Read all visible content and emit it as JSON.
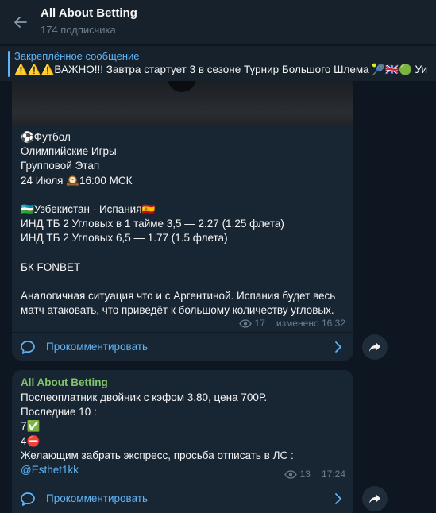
{
  "header": {
    "title": "All About Betting",
    "subtitle": "174 подписчика"
  },
  "pinned": {
    "label": "Закреплённое сообщение",
    "text": "⚠️⚠️⚠️ВАЖНО!!! Завтра стартует 3 в сезоне Турнир Большого Шлема 🎾🇬🇧🟢 Уи"
  },
  "post1": {
    "lines": [
      "⚽Футбол",
      "Олимпийские Игры",
      "Групповой Этап",
      "24 Июля 🕰️16:00 МСК",
      "",
      "🇺🇿Узбекистан - Испания🇪🇸",
      "ИНД ТБ 2 Угловых в 1 тайме 3,5 — 2.27 (1.25 флета)",
      "ИНД ТБ 2 Угловых 6,5 — 1.77 (1.5 флета)",
      "",
      "БК FONBET",
      "",
      "Аналогичная ситуация что и с Аргентиной. Испания будет весь",
      "матч атаковать, что приведёт к большому количеству угловых."
    ],
    "views": "17",
    "edited": "изменено 16:32",
    "comment_label": "Прокомментировать"
  },
  "post2": {
    "sender": "All About Betting",
    "lines": [
      "Послеоплатник двойник с кэфом 3.80, цена 700Р.",
      "Последние 10 :",
      "7✅",
      "4⛔",
      "Желающим забрать экспресс, просьба отписать в ЛС :"
    ],
    "link": "@Esthet1kk",
    "views": "13",
    "time": "17:24",
    "comment_label": "Прокомментировать"
  },
  "icons": {
    "back": "arrow-left-icon",
    "views": "eye-icon",
    "comment": "comment-bubble-icon",
    "chevron": "chevron-right-icon",
    "share": "share-arrow-icon"
  },
  "colors": {
    "background": "#0e1621",
    "header": "#17212b",
    "bubble": "#182533",
    "accent": "#5eb5f7",
    "sender": "#7fc46a",
    "muted": "#6d7f8f"
  }
}
